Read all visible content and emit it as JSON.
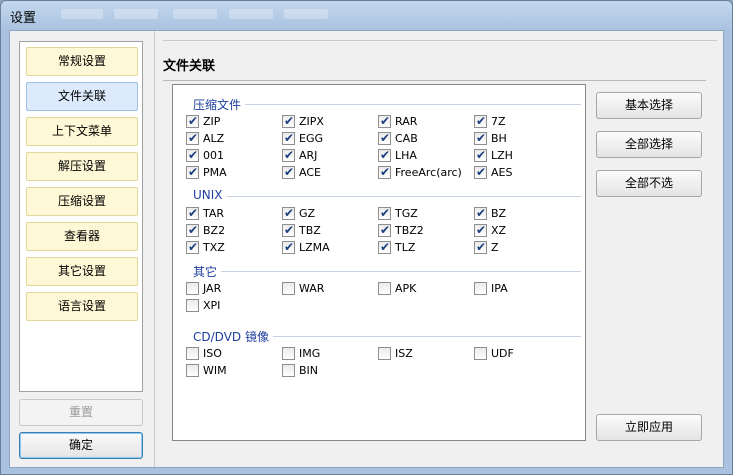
{
  "window": {
    "title": "设置"
  },
  "sidebar": {
    "items": [
      {
        "label": "常规设置",
        "active": false
      },
      {
        "label": "文件关联",
        "active": true
      },
      {
        "label": "上下文菜单",
        "active": false
      },
      {
        "label": "解压设置",
        "active": false
      },
      {
        "label": "压缩设置",
        "active": false
      },
      {
        "label": "查看器",
        "active": false
      },
      {
        "label": "其它设置",
        "active": false
      },
      {
        "label": "语言设置",
        "active": false
      }
    ],
    "reset_label": "重置",
    "ok_label": "确定"
  },
  "main": {
    "title": "文件关联",
    "groups": [
      {
        "label": "压缩文件",
        "items": [
          {
            "label": "ZIP",
            "checked": true
          },
          {
            "label": "ZIPX",
            "checked": true
          },
          {
            "label": "RAR",
            "checked": true
          },
          {
            "label": "7Z",
            "checked": true
          },
          {
            "label": "ALZ",
            "checked": true
          },
          {
            "label": "EGG",
            "checked": true
          },
          {
            "label": "CAB",
            "checked": true
          },
          {
            "label": "BH",
            "checked": true
          },
          {
            "label": "001",
            "checked": true
          },
          {
            "label": "ARJ",
            "checked": true
          },
          {
            "label": "LHA",
            "checked": true
          },
          {
            "label": "LZH",
            "checked": true
          },
          {
            "label": "PMA",
            "checked": true
          },
          {
            "label": "ACE",
            "checked": true
          },
          {
            "label": "FreeArc(arc)",
            "checked": true
          },
          {
            "label": "AES",
            "checked": true
          }
        ]
      },
      {
        "label": "UNIX",
        "items": [
          {
            "label": "TAR",
            "checked": true
          },
          {
            "label": "GZ",
            "checked": true
          },
          {
            "label": "TGZ",
            "checked": true
          },
          {
            "label": "BZ",
            "checked": true
          },
          {
            "label": "BZ2",
            "checked": true
          },
          {
            "label": "TBZ",
            "checked": true
          },
          {
            "label": "TBZ2",
            "checked": true
          },
          {
            "label": "XZ",
            "checked": true
          },
          {
            "label": "TXZ",
            "checked": true
          },
          {
            "label": "LZMA",
            "checked": true
          },
          {
            "label": "TLZ",
            "checked": true
          },
          {
            "label": "Z",
            "checked": true
          }
        ]
      },
      {
        "label": "其它",
        "items": [
          {
            "label": "JAR",
            "checked": false
          },
          {
            "label": "WAR",
            "checked": false
          },
          {
            "label": "APK",
            "checked": false
          },
          {
            "label": "IPA",
            "checked": false
          },
          {
            "label": "XPI",
            "checked": false
          }
        ]
      },
      {
        "label": "CD/DVD 镜像",
        "items": [
          {
            "label": "ISO",
            "checked": false
          },
          {
            "label": "IMG",
            "checked": false
          },
          {
            "label": "ISZ",
            "checked": false
          },
          {
            "label": "UDF",
            "checked": false
          },
          {
            "label": "WIM",
            "checked": false
          },
          {
            "label": "BIN",
            "checked": false
          }
        ]
      }
    ],
    "buttons": {
      "basic_select": "基本选择",
      "select_all": "全部选择",
      "select_none": "全部不选",
      "apply_now": "立即应用"
    }
  },
  "colors": {
    "group_label": "#1e3f9e",
    "active_item_bg": "#dceafc",
    "item_bg": "#fff8d6"
  }
}
